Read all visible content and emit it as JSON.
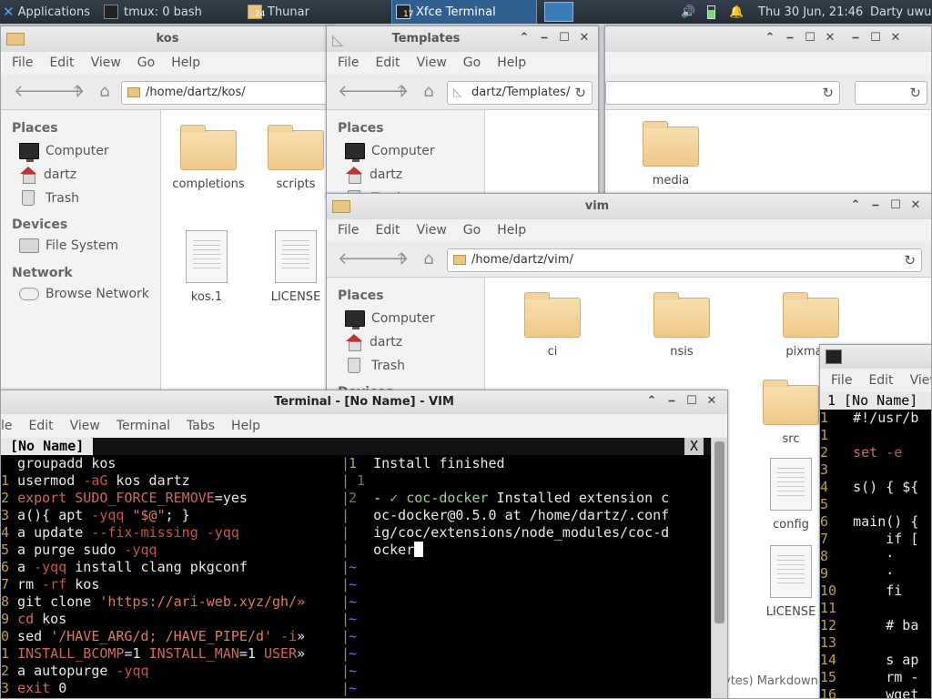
{
  "panel": {
    "apps_label": "Applications",
    "tasks": [
      {
        "label": "tmux: 0 bash"
      },
      {
        "label": "Thunar",
        "badge": "24"
      },
      {
        "label": "Xfce Terminal",
        "badge": "17"
      }
    ],
    "clock": "Thu 30 Jun, 21:46",
    "user": "Darty uwu"
  },
  "kos_window": {
    "title": "kos",
    "menu": [
      "File",
      "Edit",
      "View",
      "Go",
      "Help"
    ],
    "location": "/home/dartz/kos/",
    "places_header": "Places",
    "places": [
      "Computer",
      "dartz",
      "Trash"
    ],
    "devices_header": "Devices",
    "devices": [
      "File System"
    ],
    "network_header": "Network",
    "network": [
      "Browse Network"
    ],
    "files": [
      "completions",
      "scripts",
      "kos.1",
      "LICENSE"
    ]
  },
  "templates_window": {
    "title": "Templates",
    "menu": [
      "File",
      "Edit",
      "View",
      "Go",
      "Help"
    ],
    "location": "dartz/Templates/",
    "places_header": "Places",
    "places": [
      "Computer",
      "dartz",
      "Trash"
    ]
  },
  "bg_window": {
    "files": [
      "media"
    ]
  },
  "vim_window": {
    "title": "vim",
    "menu": [
      "File",
      "Edit",
      "View",
      "Go",
      "Help"
    ],
    "location": "/home/dartz/vim/",
    "places_header": "Places",
    "places": [
      "Computer",
      "dartz",
      "Trash"
    ],
    "devices_header": "Devices",
    "files": [
      "ci",
      "nsis",
      "pixmaps",
      "src",
      "config",
      "LICENSE"
    ],
    "status_fragment": "ytes) Markdown"
  },
  "terminal": {
    "title": "Terminal - [No Name] - VIM",
    "menu": [
      "le",
      "Edit",
      "View",
      "Terminal",
      "Tabs",
      "Help"
    ],
    "tab_label": "[No Name]",
    "tab_close": "X",
    "left_lines": [
      {
        "n": "",
        "t": "groupadd kos"
      },
      {
        "n": "1",
        "t": "usermod -aG kos dartz"
      },
      {
        "n": "2",
        "t": "export SUDO_FORCE_REMOVE=yes"
      },
      {
        "n": "3",
        "t": "a(){ apt -yqq \"$@\"; }"
      },
      {
        "n": "4",
        "t": "a update --fix-missing -yqq"
      },
      {
        "n": "5",
        "t": "a purge sudo -yqq"
      },
      {
        "n": "6",
        "t": "a -yqq install clang pkgconf"
      },
      {
        "n": "7",
        "t": "rm -rf kos"
      },
      {
        "n": "8",
        "t": "git clone 'https://ari-web.xyz/gh/»"
      },
      {
        "n": "9",
        "t": "cd kos"
      },
      {
        "n": "0",
        "t": "sed '/HAVE_ARG/d; /HAVE_PIPE/d' -i»"
      },
      {
        "n": "1",
        "t": "INSTALL_BCOMP=1 INSTALL_MAN=1 USER»"
      },
      {
        "n": "2",
        "t": "a autopurge -yqq"
      },
      {
        "n": "3",
        "t": "exit 0"
      }
    ],
    "right_lines": [
      {
        "n": "1",
        "t": "Install finished"
      },
      {
        "n": "1",
        "t": ""
      },
      {
        "n": "2",
        "t": "- ✓ coc-docker Installed extension c"
      },
      {
        "n": "",
        "t": "oc-docker@0.5.0 at /home/dartz/.conf"
      },
      {
        "n": "",
        "t": "ig/coc/extensions/node_modules/coc-d"
      },
      {
        "n": "",
        "t": "ocker"
      }
    ],
    "tilde": "~"
  },
  "right_terminal": {
    "menu": [
      "File",
      "Edit",
      "View"
    ],
    "tab_label": "1 [No Name]",
    "lines": [
      {
        "n": "1",
        "t": "#!/usr/b"
      },
      {
        "n": "1",
        "t": ""
      },
      {
        "n": "2",
        "t": "set -e"
      },
      {
        "n": "3",
        "t": ""
      },
      {
        "n": "4",
        "t": "s() { ${"
      },
      {
        "n": "5",
        "t": ""
      },
      {
        "n": "6",
        "t": "main() {"
      },
      {
        "n": "7",
        "t": "    if ["
      },
      {
        "n": "8",
        "t": "    ·"
      },
      {
        "n": "9",
        "t": "    ·"
      },
      {
        "n": "10",
        "t": "    fi"
      },
      {
        "n": "11",
        "t": ""
      },
      {
        "n": "12",
        "t": "    # ba"
      },
      {
        "n": "13",
        "t": ""
      },
      {
        "n": "14",
        "t": "    s ap"
      },
      {
        "n": "15",
        "t": "    rm -"
      },
      {
        "n": "16",
        "t": "    wget"
      }
    ]
  }
}
